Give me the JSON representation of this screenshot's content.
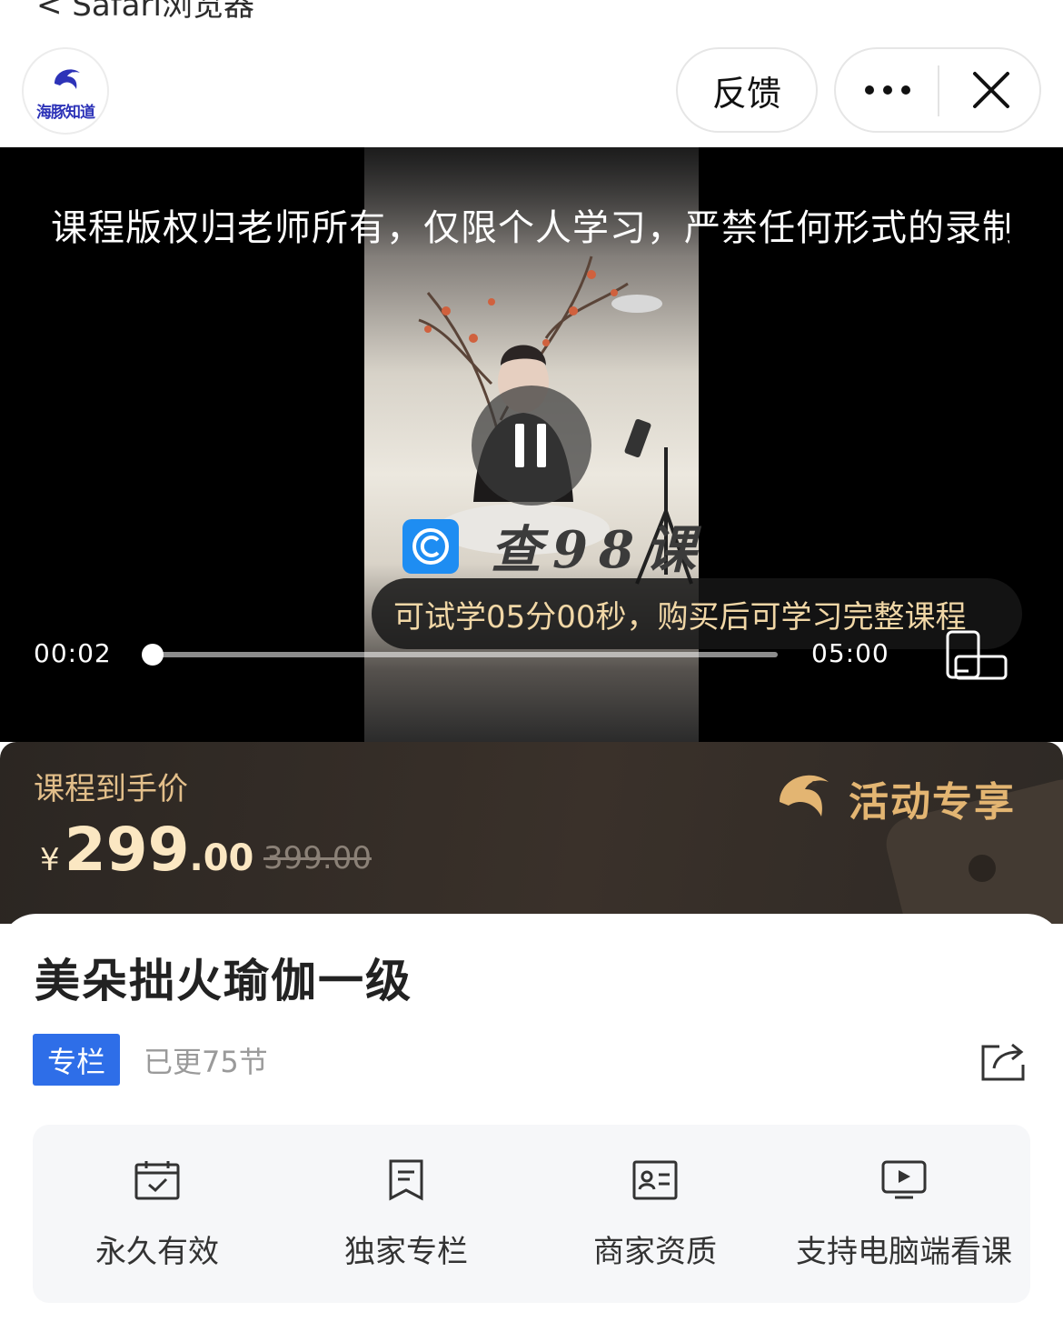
{
  "topbar": {
    "back_label": "< Safari浏览器",
    "logo_text": "海豚知道",
    "feedback_label": "反馈",
    "more_icon": "more-dots-icon",
    "close_icon": "close-icon",
    "accent_color": "#2d33b8"
  },
  "video": {
    "copyright_notice": "课程版权归老师所有，仅限个人学习，严禁任何形式的录制",
    "watermark_text": "查98课",
    "trial_tip": "可试学05分00秒，购买后可学习完整课程",
    "current_time": "00:02",
    "duration": "05:00",
    "progress": 0.007,
    "state": "playing"
  },
  "price": {
    "label": "课程到手价",
    "currency": "¥",
    "integer": "299",
    "decimal": ".00",
    "original": "399.00",
    "promo_label": "活动专享",
    "price_color": "#fbe7c2"
  },
  "course": {
    "title": "美朵拙火瑜伽一级",
    "tag": "专栏",
    "updated": "已更75节",
    "tag_color": "#2e6ee8"
  },
  "features": [
    {
      "icon": "calendar-check-icon",
      "label": "永久有效"
    },
    {
      "icon": "document-icon",
      "label": "独家专栏"
    },
    {
      "icon": "id-card-icon",
      "label": "商家资质"
    },
    {
      "icon": "monitor-play-icon",
      "label": "支持电脑端看课"
    }
  ]
}
